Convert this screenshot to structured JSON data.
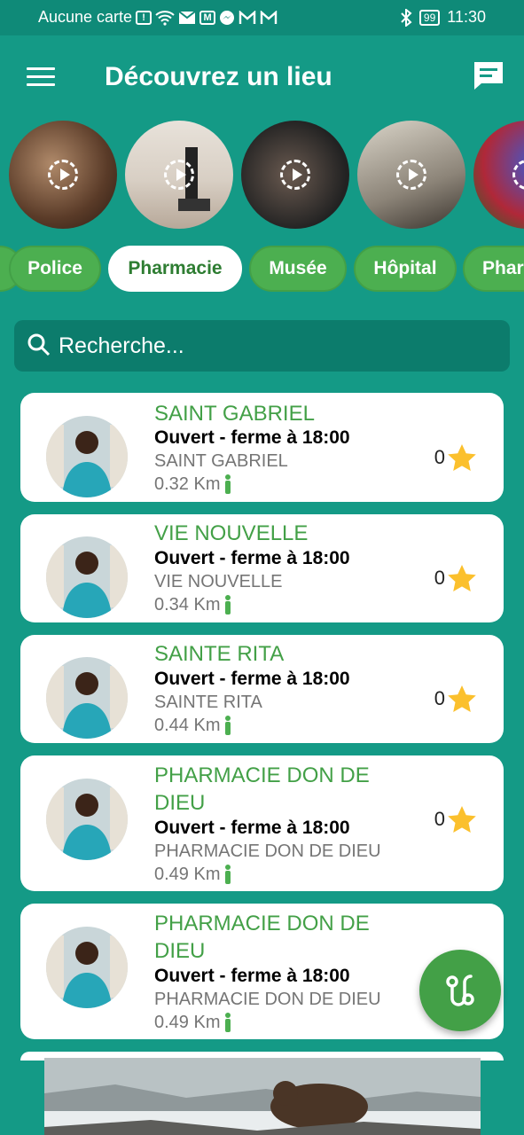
{
  "status_bar": {
    "carrier": "Aucune carte",
    "battery": "99",
    "time": "11:30"
  },
  "header": {
    "title": "Découvrez un lieu",
    "menu_icon": "menu-icon",
    "chat_icon": "chat-icon"
  },
  "stories": [
    {
      "label": "story-1"
    },
    {
      "label": "story-2"
    },
    {
      "label": "story-3"
    },
    {
      "label": "story-4"
    },
    {
      "label": "story-5"
    }
  ],
  "categories": {
    "items": [
      "Police",
      "Pharmacie",
      "Musée",
      "Hôpital",
      "Phar"
    ],
    "selected": "Pharmacie"
  },
  "search": {
    "placeholder": "Recherche..."
  },
  "places": [
    {
      "name": "SAINT GABRIEL",
      "status": "Ouvert - ferme à 18:00",
      "address": "SAINT GABRIEL",
      "distance": "0.32 Km",
      "rating": "0"
    },
    {
      "name": "VIE NOUVELLE",
      "status": "Ouvert - ferme à 18:00",
      "address": "VIE NOUVELLE",
      "distance": "0.34 Km",
      "rating": "0"
    },
    {
      "name": "SAINTE RITA",
      "status": "Ouvert - ferme à 18:00",
      "address": "SAINTE RITA",
      "distance": "0.44 Km",
      "rating": "0"
    },
    {
      "name": "PHARMACIE DON DE DIEU",
      "status": "Ouvert - ferme à 18:00",
      "address": "PHARMACIE DON DE DIEU",
      "distance": "0.49 Km",
      "rating": "0"
    },
    {
      "name": "PHARMACIE DON DE DIEU",
      "status": "Ouvert - ferme à 18:00",
      "address": "PHARMACIE DON DE DIEU",
      "distance": "0.49 Km",
      "rating": ""
    }
  ],
  "colors": {
    "background": "#149a86",
    "accent_green": "#43a047",
    "star": "#fbc02d"
  }
}
